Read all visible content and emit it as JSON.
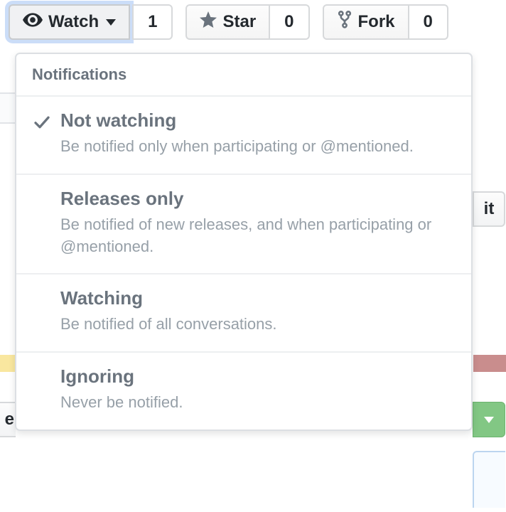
{
  "toolbar": {
    "watch": {
      "label": "Watch",
      "count": "1"
    },
    "star": {
      "label": "Star",
      "count": "0"
    },
    "fork": {
      "label": "Fork",
      "count": "0"
    }
  },
  "dropdown": {
    "header": "Notifications",
    "options": [
      {
        "title": "Not watching",
        "desc": "Be notified only when participating or @mentioned.",
        "selected": true
      },
      {
        "title": "Releases only",
        "desc": "Be notified of new releases, and when participating or @mentioned.",
        "selected": false
      },
      {
        "title": "Watching",
        "desc": "Be notified of all conversations.",
        "selected": false
      },
      {
        "title": "Ignoring",
        "desc": "Never be notified.",
        "selected": false
      }
    ]
  },
  "partial": {
    "it": "it",
    "e": "e"
  }
}
